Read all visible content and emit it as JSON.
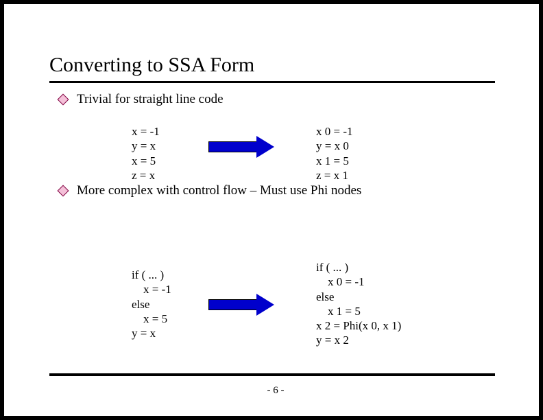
{
  "title": "Converting to SSA Form",
  "bullets": {
    "b1": "Trivial for straight line code",
    "b2": "More complex with control flow – Must use Phi nodes"
  },
  "code": {
    "left1": "x = -1\ny = x\nx = 5\nz = x",
    "right1": "x 0 = -1\ny = x 0\nx 1 = 5\nz = x 1",
    "left2": "if ( ... )\n    x = -1\nelse\n    x = 5\ny = x",
    "right2": "if ( ... )\n    x 0 = -1\nelse\n    x 1 = 5\nx 2 = Phi(x 0, x 1)\ny = x 2"
  },
  "page": "- 6 -"
}
